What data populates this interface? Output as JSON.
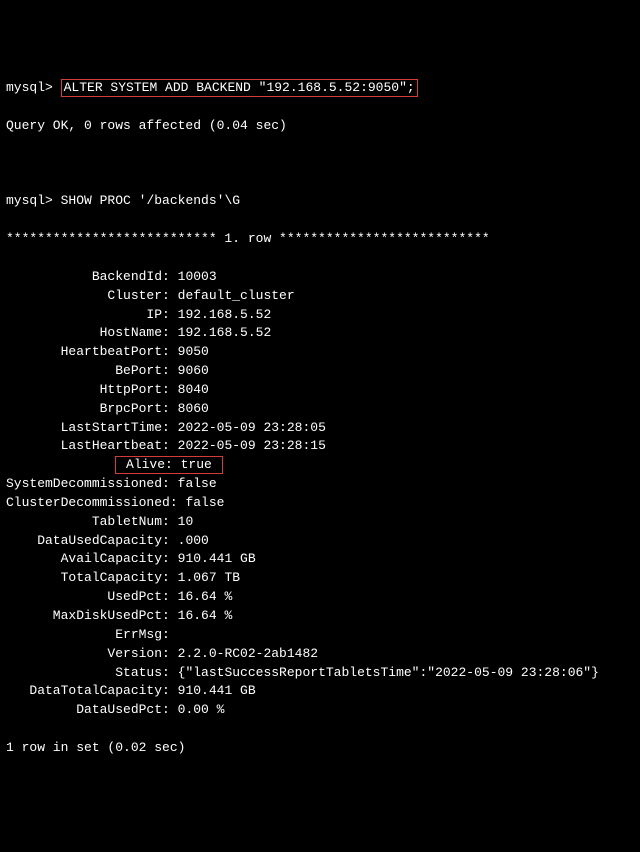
{
  "prompt": "mysql>",
  "cmd1": "ALTER SYSTEM ADD BACKEND \"192.168.5.52:9050\";",
  "result1": "Query OK, 0 rows affected (0.04 sec)",
  "cmd2": "SHOW PROC '/backends'\\G",
  "row_header": "*************************** 1. row ***************************",
  "fields": [
    {
      "label": "BackendId",
      "value": "10003"
    },
    {
      "label": "Cluster",
      "value": "default_cluster"
    },
    {
      "label": "IP",
      "value": "192.168.5.52"
    },
    {
      "label": "HostName",
      "value": "192.168.5.52"
    },
    {
      "label": "HeartbeatPort",
      "value": "9050"
    },
    {
      "label": "BePort",
      "value": "9060"
    },
    {
      "label": "HttpPort",
      "value": "8040"
    },
    {
      "label": "BrpcPort",
      "value": "8060"
    },
    {
      "label": "LastStartTime",
      "value": "2022-05-09 23:28:05"
    },
    {
      "label": "LastHeartbeat",
      "value": "2022-05-09 23:28:15"
    },
    {
      "label": "Alive",
      "value": "true",
      "boxed": true
    },
    {
      "label": "SystemDecommissioned",
      "value": "false"
    },
    {
      "label": "ClusterDecommissioned",
      "value": "false"
    },
    {
      "label": "TabletNum",
      "value": "10"
    },
    {
      "label": "DataUsedCapacity",
      "value": ".000 "
    },
    {
      "label": "AvailCapacity",
      "value": "910.441 GB"
    },
    {
      "label": "TotalCapacity",
      "value": "1.067 TB"
    },
    {
      "label": "UsedPct",
      "value": "16.64 %"
    },
    {
      "label": "MaxDiskUsedPct",
      "value": "16.64 %"
    },
    {
      "label": "ErrMsg",
      "value": ""
    },
    {
      "label": "Version",
      "value": "2.2.0-RC02-2ab1482"
    },
    {
      "label": "Status",
      "value": "{\"lastSuccessReportTabletsTime\":\"2022-05-09 23:28:06\"}"
    },
    {
      "label": "DataTotalCapacity",
      "value": "910.441 GB"
    },
    {
      "label": "DataUsedPct",
      "value": "0.00 %"
    }
  ],
  "footer": "1 row in set (0.02 sec)"
}
